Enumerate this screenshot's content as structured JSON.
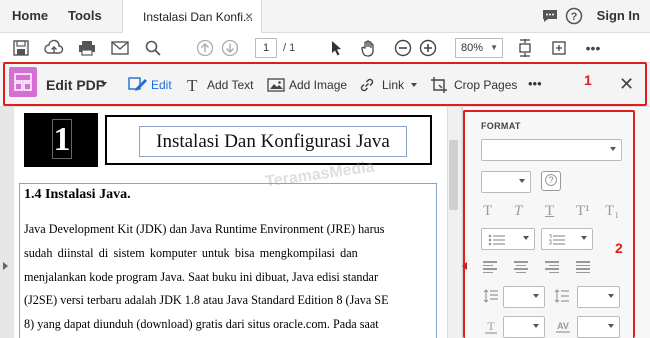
{
  "menubar": {
    "home": "Home",
    "tools": "Tools",
    "doc_tab": "Instalasi Dan Konfi...",
    "close": "×",
    "signin": "Sign In"
  },
  "toolbar": {
    "page_current": "1",
    "page_total": "/ 1",
    "zoom": "80%"
  },
  "editbar": {
    "title": "Edit PDF",
    "edit": "Edit",
    "add_text": "Add Text",
    "add_image": "Add Image",
    "link": "Link",
    "crop_pages": "Crop Pages",
    "more": "•••",
    "close": "✕",
    "callout_number": "1",
    "accent_color": "#1a6fd6",
    "highlight_color": "#e01d1d"
  },
  "document": {
    "chapter_number": "1",
    "chapter_title": "Instalasi Dan Konfigurasi Java",
    "watermark": "TeramasMedia",
    "section_heading": "1.4   Instalasi Java.",
    "lines": [
      "Java Development Kit (JDK) dan Java Runtime Environment (JRE) harus",
      "sudah diinstal di sistem komputer untuk bisa mengkompilasi dan",
      "menjalankan kode program Java. Saat buku ini dibuat, Java edisi standar",
      "(J2SE) versi terbaru adalah JDK 1.8 atau Java Standard Edition 8 (Java SE",
      "8) yang dapat diunduh (download) gratis dari situs oracle.com. Pada saat"
    ]
  },
  "format_panel": {
    "title": "FORMAT",
    "help": "?",
    "callout_number": "2",
    "text_styles": [
      "T",
      "T",
      "T",
      "T¹",
      "T₁"
    ]
  }
}
